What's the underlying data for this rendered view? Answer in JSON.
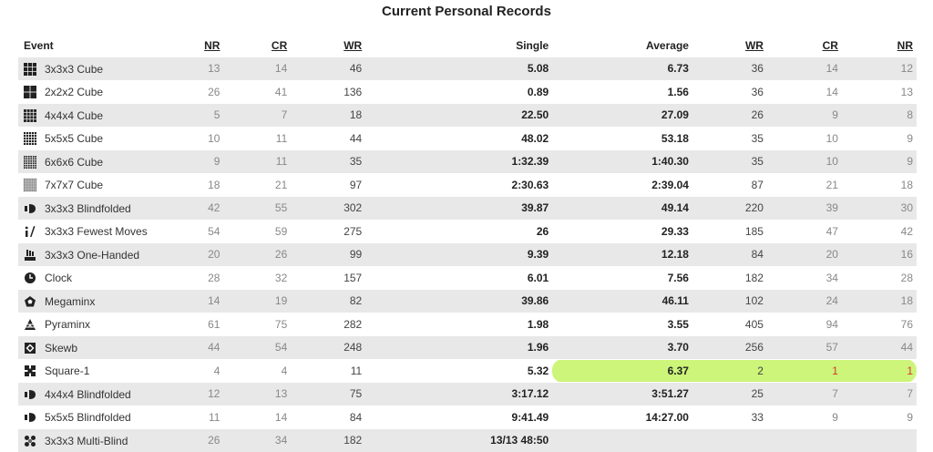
{
  "title": "Current Personal Records",
  "headers": {
    "event": "Event",
    "nr": "NR",
    "cr": "CR",
    "wr": "WR",
    "single": "Single",
    "average": "Average",
    "wr2": "WR",
    "cr2": "CR",
    "nr2": "NR"
  },
  "highlight_color": "#ccf57a",
  "rows": [
    {
      "icon": "cube-333-icon",
      "event": "3x3x3 Cube",
      "nr": "13",
      "cr": "14",
      "wr": "46",
      "single": "5.08",
      "average": "6.73",
      "awr": "36",
      "acr": "14",
      "anr": "12"
    },
    {
      "icon": "cube-222-icon",
      "event": "2x2x2 Cube",
      "nr": "26",
      "cr": "41",
      "wr": "136",
      "single": "0.89",
      "average": "1.56",
      "awr": "36",
      "acr": "14",
      "anr": "13"
    },
    {
      "icon": "cube-444-icon",
      "event": "4x4x4 Cube",
      "nr": "5",
      "cr": "7",
      "wr": "18",
      "single": "22.50",
      "average": "27.09",
      "awr": "26",
      "acr": "9",
      "anr": "8"
    },
    {
      "icon": "cube-555-icon",
      "event": "5x5x5 Cube",
      "nr": "10",
      "cr": "11",
      "wr": "44",
      "single": "48.02",
      "average": "53.18",
      "awr": "35",
      "acr": "10",
      "anr": "9"
    },
    {
      "icon": "cube-666-icon",
      "event": "6x6x6 Cube",
      "nr": "9",
      "cr": "11",
      "wr": "35",
      "single": "1:32.39",
      "average": "1:40.30",
      "awr": "35",
      "acr": "10",
      "anr": "9"
    },
    {
      "icon": "cube-777-icon",
      "event": "7x7x7 Cube",
      "nr": "18",
      "cr": "21",
      "wr": "97",
      "single": "2:30.63",
      "average": "2:39.04",
      "awr": "87",
      "acr": "21",
      "anr": "18"
    },
    {
      "icon": "blindfolded-333-icon",
      "event": "3x3x3 Blindfolded",
      "nr": "42",
      "cr": "55",
      "wr": "302",
      "single": "39.87",
      "average": "49.14",
      "awr": "220",
      "acr": "39",
      "anr": "30"
    },
    {
      "icon": "fewest-moves-icon",
      "event": "3x3x3 Fewest Moves",
      "nr": "54",
      "cr": "59",
      "wr": "275",
      "single": "26",
      "average": "29.33",
      "awr": "185",
      "acr": "47",
      "anr": "42"
    },
    {
      "icon": "one-handed-icon",
      "event": "3x3x3 One-Handed",
      "nr": "20",
      "cr": "26",
      "wr": "99",
      "single": "9.39",
      "average": "12.18",
      "awr": "84",
      "acr": "20",
      "anr": "16"
    },
    {
      "icon": "clock-icon",
      "event": "Clock",
      "nr": "28",
      "cr": "32",
      "wr": "157",
      "single": "6.01",
      "average": "7.56",
      "awr": "182",
      "acr": "34",
      "anr": "28"
    },
    {
      "icon": "megaminx-icon",
      "event": "Megaminx",
      "nr": "14",
      "cr": "19",
      "wr": "82",
      "single": "39.86",
      "average": "46.11",
      "awr": "102",
      "acr": "24",
      "anr": "18"
    },
    {
      "icon": "pyraminx-icon",
      "event": "Pyraminx",
      "nr": "61",
      "cr": "75",
      "wr": "282",
      "single": "1.98",
      "average": "3.55",
      "awr": "405",
      "acr": "94",
      "anr": "76"
    },
    {
      "icon": "skewb-icon",
      "event": "Skewb",
      "nr": "44",
      "cr": "54",
      "wr": "248",
      "single": "1.96",
      "average": "3.70",
      "awr": "256",
      "acr": "57",
      "anr": "44"
    },
    {
      "icon": "square-1-icon",
      "event": "Square-1",
      "nr": "4",
      "cr": "4",
      "wr": "11",
      "single": "5.32",
      "average": "6.37",
      "awr": "2",
      "acr": "1",
      "anr": "1",
      "highlight": true
    },
    {
      "icon": "blindfolded-444-icon",
      "event": "4x4x4 Blindfolded",
      "nr": "12",
      "cr": "13",
      "wr": "75",
      "single": "3:17.12",
      "average": "3:51.27",
      "awr": "25",
      "acr": "7",
      "anr": "7"
    },
    {
      "icon": "blindfolded-555-icon",
      "event": "5x5x5 Blindfolded",
      "nr": "11",
      "cr": "14",
      "wr": "84",
      "single": "9:41.49",
      "average": "14:27.00",
      "awr": "33",
      "acr": "9",
      "anr": "9"
    },
    {
      "icon": "multi-blind-icon",
      "event": "3x3x3 Multi-Blind",
      "nr": "26",
      "cr": "34",
      "wr": "182",
      "single": "13/13 48:50",
      "average": "",
      "awr": "",
      "acr": "",
      "anr": ""
    }
  ]
}
